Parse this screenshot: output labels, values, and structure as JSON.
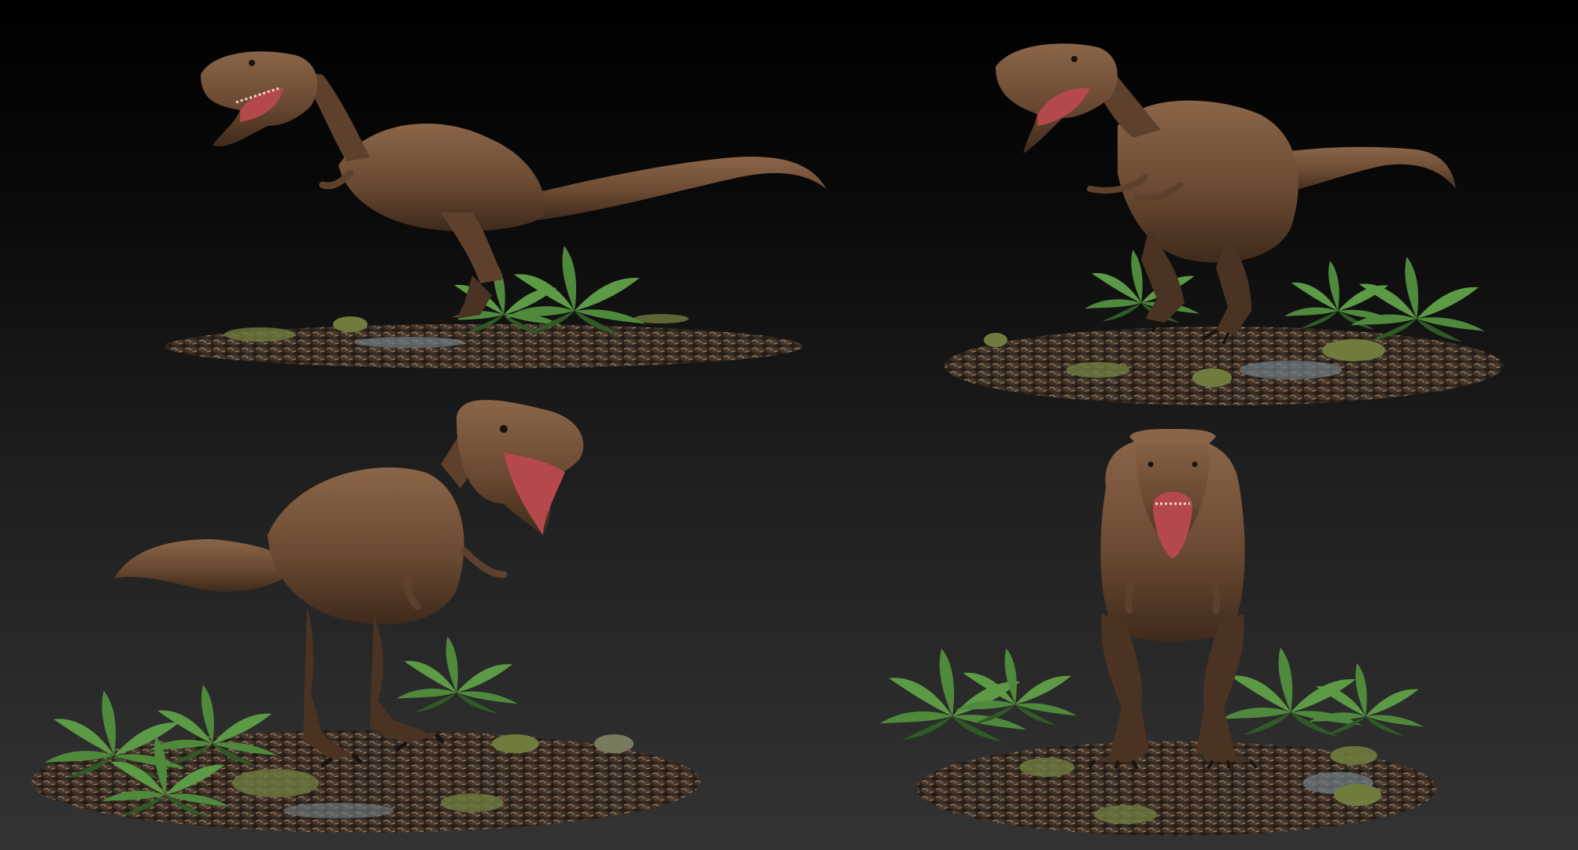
{
  "scene": {
    "subject": "tyrannosaurus-sculpt",
    "views": [
      {
        "id": "side-view"
      },
      {
        "id": "three-quarter-right-view"
      },
      {
        "id": "three-quarter-left-view"
      },
      {
        "id": "front-view"
      }
    ]
  },
  "colors": {
    "background_top": "#000000",
    "background_bottom": "#333333",
    "skin": "#6b4a32",
    "skin_shadow": "#3e2a1c",
    "skin_highlight": "#8a6548",
    "mouth": "#b4484a",
    "teeth": "#e8ddc8",
    "base_ground": "#3a2e25",
    "base_highlight": "#b79a7c",
    "fern": "#4f8a3c",
    "fern_dark": "#2f5a26",
    "moss": "#6f7c3e",
    "water": "#6f7e86"
  }
}
